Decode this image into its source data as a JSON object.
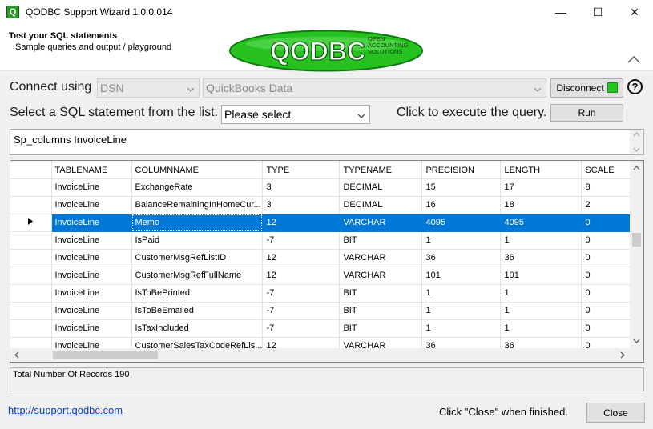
{
  "window": {
    "title": "QODBC Support Wizard  1.0.0.014",
    "minimize": "—",
    "maximize": "☐",
    "close": "✕"
  },
  "header": {
    "title": "Test your SQL statements",
    "subtitle": "Sample queries and output / playground",
    "logo_text": "QODBC",
    "logo_tagline": [
      "OPEN",
      "ACCOUNTING",
      "SOLUTIONS"
    ]
  },
  "connect": {
    "label": "Connect using",
    "mode": "DSN",
    "dsn": "QuickBooks Data",
    "disconnect_label": "Disconnect",
    "status_color": "#22c61f"
  },
  "select": {
    "label": "Select a SQL statement from the list.",
    "value": "Please select",
    "execute_label": "Click to execute the query.",
    "run_label": "Run"
  },
  "sql": {
    "text": "Sp_columns InvoiceLine"
  },
  "grid": {
    "columns": [
      "TABLENAME",
      "COLUMNNAME",
      "TYPE",
      "TYPENAME",
      "PRECISION",
      "LENGTH",
      "SCALE"
    ],
    "selected_row": 2,
    "rows": [
      [
        "InvoiceLine",
        "ExchangeRate",
        "3",
        "DECIMAL",
        "15",
        "17",
        "8"
      ],
      [
        "InvoiceLine",
        "BalanceRemainingInHomeCur...",
        "3",
        "DECIMAL",
        "16",
        "18",
        "2"
      ],
      [
        "InvoiceLine",
        "Memo",
        "12",
        "VARCHAR",
        "4095",
        "4095",
        "0"
      ],
      [
        "InvoiceLine",
        "IsPaid",
        "-7",
        "BIT",
        "1",
        "1",
        "0"
      ],
      [
        "InvoiceLine",
        "CustomerMsgRefListID",
        "12",
        "VARCHAR",
        "36",
        "36",
        "0"
      ],
      [
        "InvoiceLine",
        "CustomerMsgRefFullName",
        "12",
        "VARCHAR",
        "101",
        "101",
        "0"
      ],
      [
        "InvoiceLine",
        "IsToBePrinted",
        "-7",
        "BIT",
        "1",
        "1",
        "0"
      ],
      [
        "InvoiceLine",
        "IsToBeEmailed",
        "-7",
        "BIT",
        "1",
        "1",
        "0"
      ],
      [
        "InvoiceLine",
        "IsTaxIncluded",
        "-7",
        "BIT",
        "1",
        "1",
        "0"
      ],
      [
        "InvoiceLine",
        "CustomerSalesTaxCodeRefLis...",
        "12",
        "VARCHAR",
        "36",
        "36",
        "0"
      ]
    ]
  },
  "status": {
    "text": "Total Number Of Records 190"
  },
  "footer": {
    "link": "http://support.qodbc.com",
    "note": "Click \"Close\" when finished.",
    "close_label": "Close"
  },
  "colors": {
    "selection": "#0078d7",
    "logo_green": "#22c61f"
  }
}
